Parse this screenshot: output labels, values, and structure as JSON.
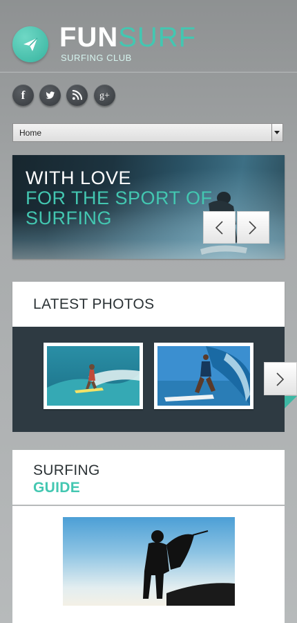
{
  "brand": {
    "name_part1": "FUN",
    "name_part2": "SURF",
    "tagline": "SURFING CLUB"
  },
  "social": [
    {
      "name": "facebook-icon",
      "glyph": "f"
    },
    {
      "name": "twitter-icon",
      "glyph": ""
    },
    {
      "name": "rss-icon",
      "glyph": ""
    },
    {
      "name": "googleplus-icon",
      "glyph": "g+"
    }
  ],
  "nav": {
    "selected": "Home"
  },
  "hero": {
    "line1": "WITH LOVE",
    "line2": "FOR THE SPORT OF",
    "line3": "SURFING"
  },
  "latest_photos": {
    "title": "LATEST PHOTOS"
  },
  "guide": {
    "title_line1": "SURFING",
    "title_line2": "GUIDE"
  },
  "colors": {
    "accent": "#43c7b1",
    "dark_band": "#2e3a42",
    "background": "#a9acad"
  }
}
